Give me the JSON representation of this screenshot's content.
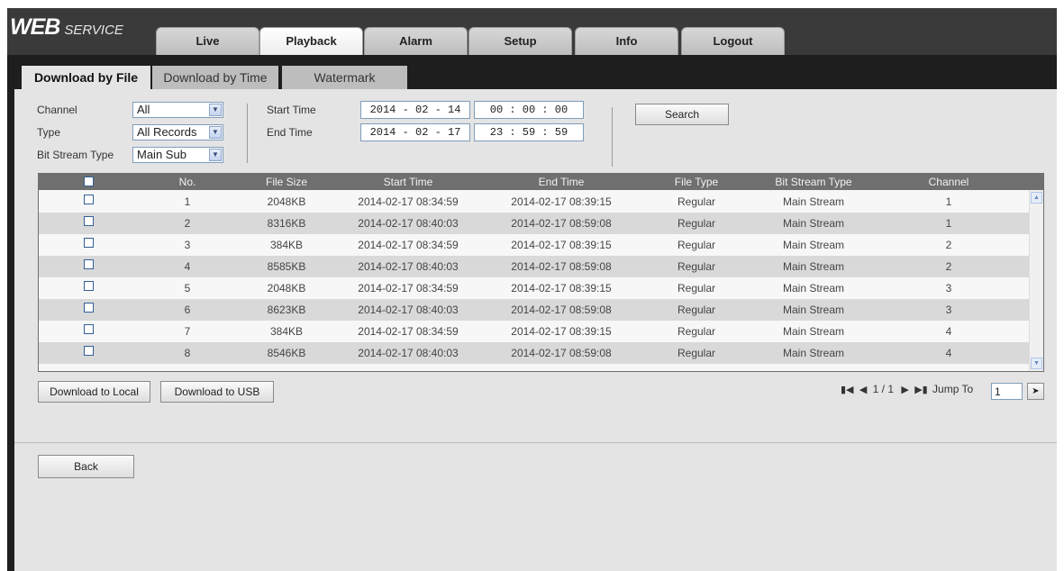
{
  "logo": {
    "web": "WEB",
    "service": "SERVICE"
  },
  "nav": {
    "tabs": [
      "Live",
      "Playback",
      "Alarm",
      "Setup",
      "Info",
      "Logout"
    ],
    "active": "Playback"
  },
  "subtabs": [
    "Download by File",
    "Download by Time",
    "Watermark"
  ],
  "form": {
    "channel_label": "Channel",
    "channel_value": "All",
    "type_label": "Type",
    "type_value": "All Records",
    "bitstream_label": "Bit Stream Type",
    "bitstream_value": "Main Sub",
    "start_label": "Start Time",
    "start_date": "2014 -  02  -  14",
    "start_time": "00  :  00  :  00",
    "end_label": "End Time",
    "end_date": "2014 -  02  -  17",
    "end_time": "23  :  59  :  59",
    "search_button": "Search"
  },
  "table": {
    "headers": [
      "No.",
      "File Size",
      "Start Time",
      "End Time",
      "File Type",
      "Bit Stream Type",
      "Channel"
    ],
    "rows": [
      [
        "1",
        "2048KB",
        "2014-02-17 08:34:59",
        "2014-02-17 08:39:15",
        "Regular",
        "Main Stream",
        "1"
      ],
      [
        "2",
        "8316KB",
        "2014-02-17 08:40:03",
        "2014-02-17 08:59:08",
        "Regular",
        "Main Stream",
        "1"
      ],
      [
        "3",
        "384KB",
        "2014-02-17 08:34:59",
        "2014-02-17 08:39:15",
        "Regular",
        "Main Stream",
        "2"
      ],
      [
        "4",
        "8585KB",
        "2014-02-17 08:40:03",
        "2014-02-17 08:59:08",
        "Regular",
        "Main Stream",
        "2"
      ],
      [
        "5",
        "2048KB",
        "2014-02-17 08:34:59",
        "2014-02-17 08:39:15",
        "Regular",
        "Main Stream",
        "3"
      ],
      [
        "6",
        "8623KB",
        "2014-02-17 08:40:03",
        "2014-02-17 08:59:08",
        "Regular",
        "Main Stream",
        "3"
      ],
      [
        "7",
        "384KB",
        "2014-02-17 08:34:59",
        "2014-02-17 08:39:15",
        "Regular",
        "Main Stream",
        "4"
      ],
      [
        "8",
        "8546KB",
        "2014-02-17 08:40:03",
        "2014-02-17 08:59:08",
        "Regular",
        "Main Stream",
        "4"
      ]
    ]
  },
  "actions": {
    "download_local": "Download to Local",
    "download_usb": "Download to USB",
    "back": "Back"
  },
  "pagination": {
    "page": "1 / 1",
    "jump_label": "Jump To",
    "jump_value": "1"
  },
  "colors": {
    "topbar": "#3a3a3a",
    "header_row": "#6f6f6f",
    "content_bg": "#e4e4e4"
  },
  "icons": [
    "first-page-icon",
    "prev-page-icon",
    "next-page-icon",
    "last-page-icon",
    "go-icon",
    "dropdown-arrow-icon",
    "scroll-up-icon",
    "scroll-down-icon"
  ]
}
